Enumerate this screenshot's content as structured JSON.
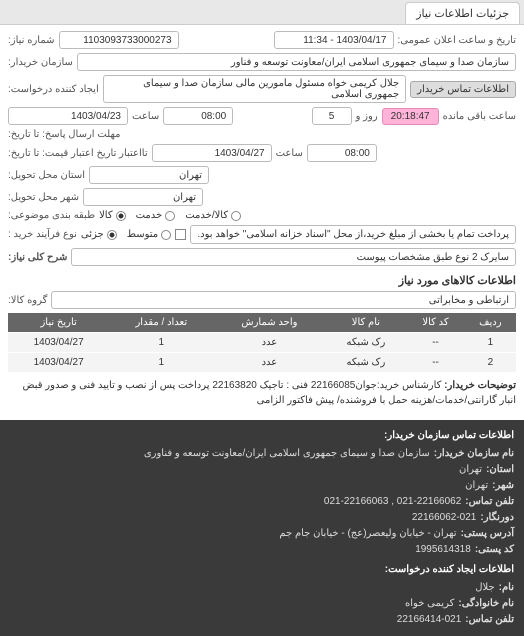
{
  "tab": {
    "label": "جزئیات اطلاعات نیاز"
  },
  "header": {
    "need_no_label": "شماره نیاز:",
    "need_no": "1103093733000273",
    "announce_label": "تاریخ و ساعت اعلان عمومی:",
    "announce_value": "1403/04/17 - 11:34",
    "buyer_label": "سازمان خریدار:",
    "buyer_value": "سازمان صدا و سیمای جمهوری اسلامی ایران/معاونت توسعه و فناور",
    "creator_label": "ایجاد کننده درخواست:",
    "creator_value": "جلال کریمی خواه مسئول مامورین مالی   سازمان صدا و سیمای جمهوری اسلامی",
    "contact_btn": "اطلاعات تماس خریدار",
    "deadline_label": "مهلت ارسال پاسخ: تا تاریخ:",
    "deadline_date": "1403/04/23",
    "deadline_time_label": "ساعت",
    "deadline_time": "08:00",
    "days_count": "5",
    "days_label": "روز و",
    "countdown": "20:18:47",
    "remain_label": "ساعت باقی مانده",
    "valid_label": "تااعتبار تاریخ اعتبار قیمت: تا تاریخ:",
    "valid_date": "1403/04/27",
    "valid_time": "08:00",
    "delivery_prov_label": "استان محل تحویل:",
    "delivery_prov": "تهران",
    "delivery_city_label": "شهر محل تحویل:",
    "delivery_city": "تهران",
    "budget_label": "طبقه بندی موضوعی:",
    "budget_opts": {
      "goods": "کالا",
      "service": "خدمت",
      "both": "کالا/خدمت"
    },
    "process_label": "نوع فرآیند خرید :",
    "process_opts": {
      "low": "جزئی",
      "mid": "متوسط"
    },
    "process_note": "پرداخت تمام یا بخشی از مبلغ خرید،از محل \"اسناد خزانه اسلامی\" خواهد بود.",
    "overall_label": "شرح کلی نیاز:",
    "overall_value": "سایرک 2 نوع طبق مشخصات پیوست"
  },
  "goods_section": {
    "title": "اطلاعات کالاهای مورد نیاز",
    "group_label": "گروه کالا:",
    "group_value": "ارتباطی و مخابراتی",
    "columns": [
      "ردیف",
      "کد کالا",
      "نام کالا",
      "واحد شمارش",
      "تعداد / مقدار",
      "تاریخ نیاز"
    ],
    "rows": [
      {
        "idx": "1",
        "code": "--",
        "name": "رک شبکه",
        "unit": "عدد",
        "qty": "1",
        "date": "1403/04/27"
      },
      {
        "idx": "2",
        "code": "--",
        "name": "رک شبکه",
        "unit": "عدد",
        "qty": "1",
        "date": "1403/04/27"
      }
    ]
  },
  "notes": {
    "buyer_note_label": "توضیحات خریدار:",
    "buyer_note": "کارشناس خرید:جوان22166085 فنی : تاجیک 22163820 پرداخت پس از نصب و تایید فنی و صدور قبض انبار گارانتی/خدمات/هزینه حمل با فروشنده/ پیش فاکتور الزامی"
  },
  "footer": {
    "title1": "اطلاعات تماس سازمان خریدار:",
    "org_label": "نام سازمان خریدار:",
    "org_value": "سازمان صدا و سیمای جمهوری اسلامی ایران/معاونت توسعه و فناوری",
    "prov_label": "استان:",
    "prov_value": "تهران",
    "city_label": "شهر:",
    "city_value": "تهران",
    "tel_label": "تلفن تماس:",
    "tel_value": "021-22166062 , 021-22166063",
    "fax_label": "دورنگار:",
    "fax_value": "22166062-021",
    "addr_label": "آدرس پستی:",
    "addr_value": "تهران - خیابان ولیعصر(عج) - خیابان جام جم",
    "zip_label": "کد پستی:",
    "zip_value": "1995614318",
    "title2": "اطلاعات ایجاد کننده درخواست:",
    "fname_label": "نام:",
    "fname_value": "جلال",
    "lname_label": "نام خانوادگی:",
    "lname_value": "کریمی خواه",
    "phone_label": "تلفن تماس:",
    "phone_value": "22166414-021"
  }
}
